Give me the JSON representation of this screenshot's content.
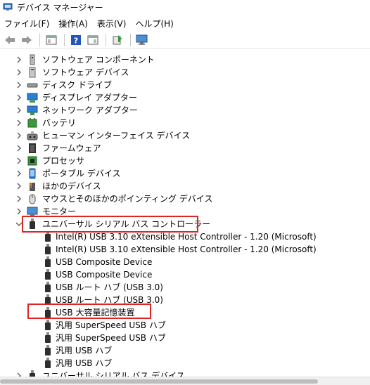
{
  "window": {
    "title": "デバイス マネージャー"
  },
  "menubar": [
    "ファイル(F)",
    "操作(A)",
    "表示(V)",
    "ヘルプ(H)"
  ],
  "toolbar": {
    "buttons": [
      "back-icon",
      "forward-icon",
      "properties-panel-icon",
      "help-icon",
      "view-icon",
      "update-driver-icon",
      "monitor-scan-icon"
    ]
  },
  "tree": {
    "categories_top": [
      {
        "label": "ソフトウェア コンポーネント",
        "icon": "software-component-icon"
      },
      {
        "label": "ソフトウェア デバイス",
        "icon": "software-device-icon"
      },
      {
        "label": "ディスク ドライブ",
        "icon": "disk-drive-icon"
      },
      {
        "label": "ディスプレイ アダプター",
        "icon": "display-adapter-icon"
      },
      {
        "label": "ネットワーク アダプター",
        "icon": "network-adapter-icon"
      },
      {
        "label": "バッテリ",
        "icon": "battery-icon"
      },
      {
        "label": "ヒューマン インターフェイス デバイス",
        "icon": "hid-icon"
      },
      {
        "label": "ファームウェア",
        "icon": "firmware-icon"
      },
      {
        "label": "プロセッサ",
        "icon": "processor-icon"
      },
      {
        "label": "ポータブル デバイス",
        "icon": "portable-device-icon"
      },
      {
        "label": "ほかのデバイス",
        "icon": "other-device-icon"
      },
      {
        "label": "マウスとそのほかのポインティング デバイス",
        "icon": "mouse-icon"
      },
      {
        "label": "モニター",
        "icon": "monitor-icon"
      }
    ],
    "expanded_category": {
      "label": "ユニバーサル シリアル バス コントローラー",
      "icon": "usb-icon"
    },
    "usb_devices": [
      "Intel(R) USB 3.10 eXtensible Host Controller - 1.20 (Microsoft)",
      "Intel(R) USB 3.10 eXtensible Host Controller - 1.20 (Microsoft)",
      "USB Composite Device",
      "USB Composite Device",
      "USB ルート ハブ (USB 3.0)",
      "USB ルート ハブ (USB 3.0)",
      "USB 大容量記憶装置",
      "汎用 SuperSpeed USB ハブ",
      "汎用 SuperSpeed USB ハブ",
      "汎用 USB ハブ",
      "汎用 USB ハブ"
    ],
    "categories_bottom": [
      {
        "label": "ユニバーサル シリアル バス デバイス",
        "icon": "usb-icon"
      }
    ]
  },
  "highlight_color": "#e02424"
}
